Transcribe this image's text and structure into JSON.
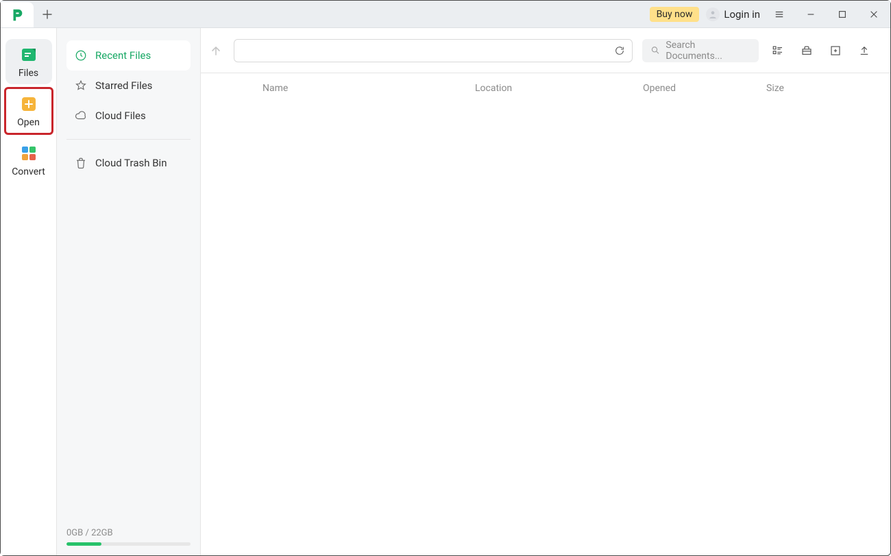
{
  "titlebar": {
    "buy_label": "Buy now",
    "login_label": "Login in"
  },
  "rail": {
    "items": [
      {
        "label": "Files"
      },
      {
        "label": "Open"
      },
      {
        "label": "Convert"
      }
    ]
  },
  "nav": {
    "items": [
      {
        "label": "Recent Files"
      },
      {
        "label": "Starred Files"
      },
      {
        "label": "Cloud Files"
      },
      {
        "label": "Cloud Trash Bin"
      }
    ]
  },
  "storage": {
    "text": "0GB / 22GB",
    "percent": 28
  },
  "search": {
    "placeholder": "Search Documents..."
  },
  "table": {
    "columns": {
      "name": "Name",
      "location": "Location",
      "opened": "Opened",
      "size": "Size"
    }
  }
}
